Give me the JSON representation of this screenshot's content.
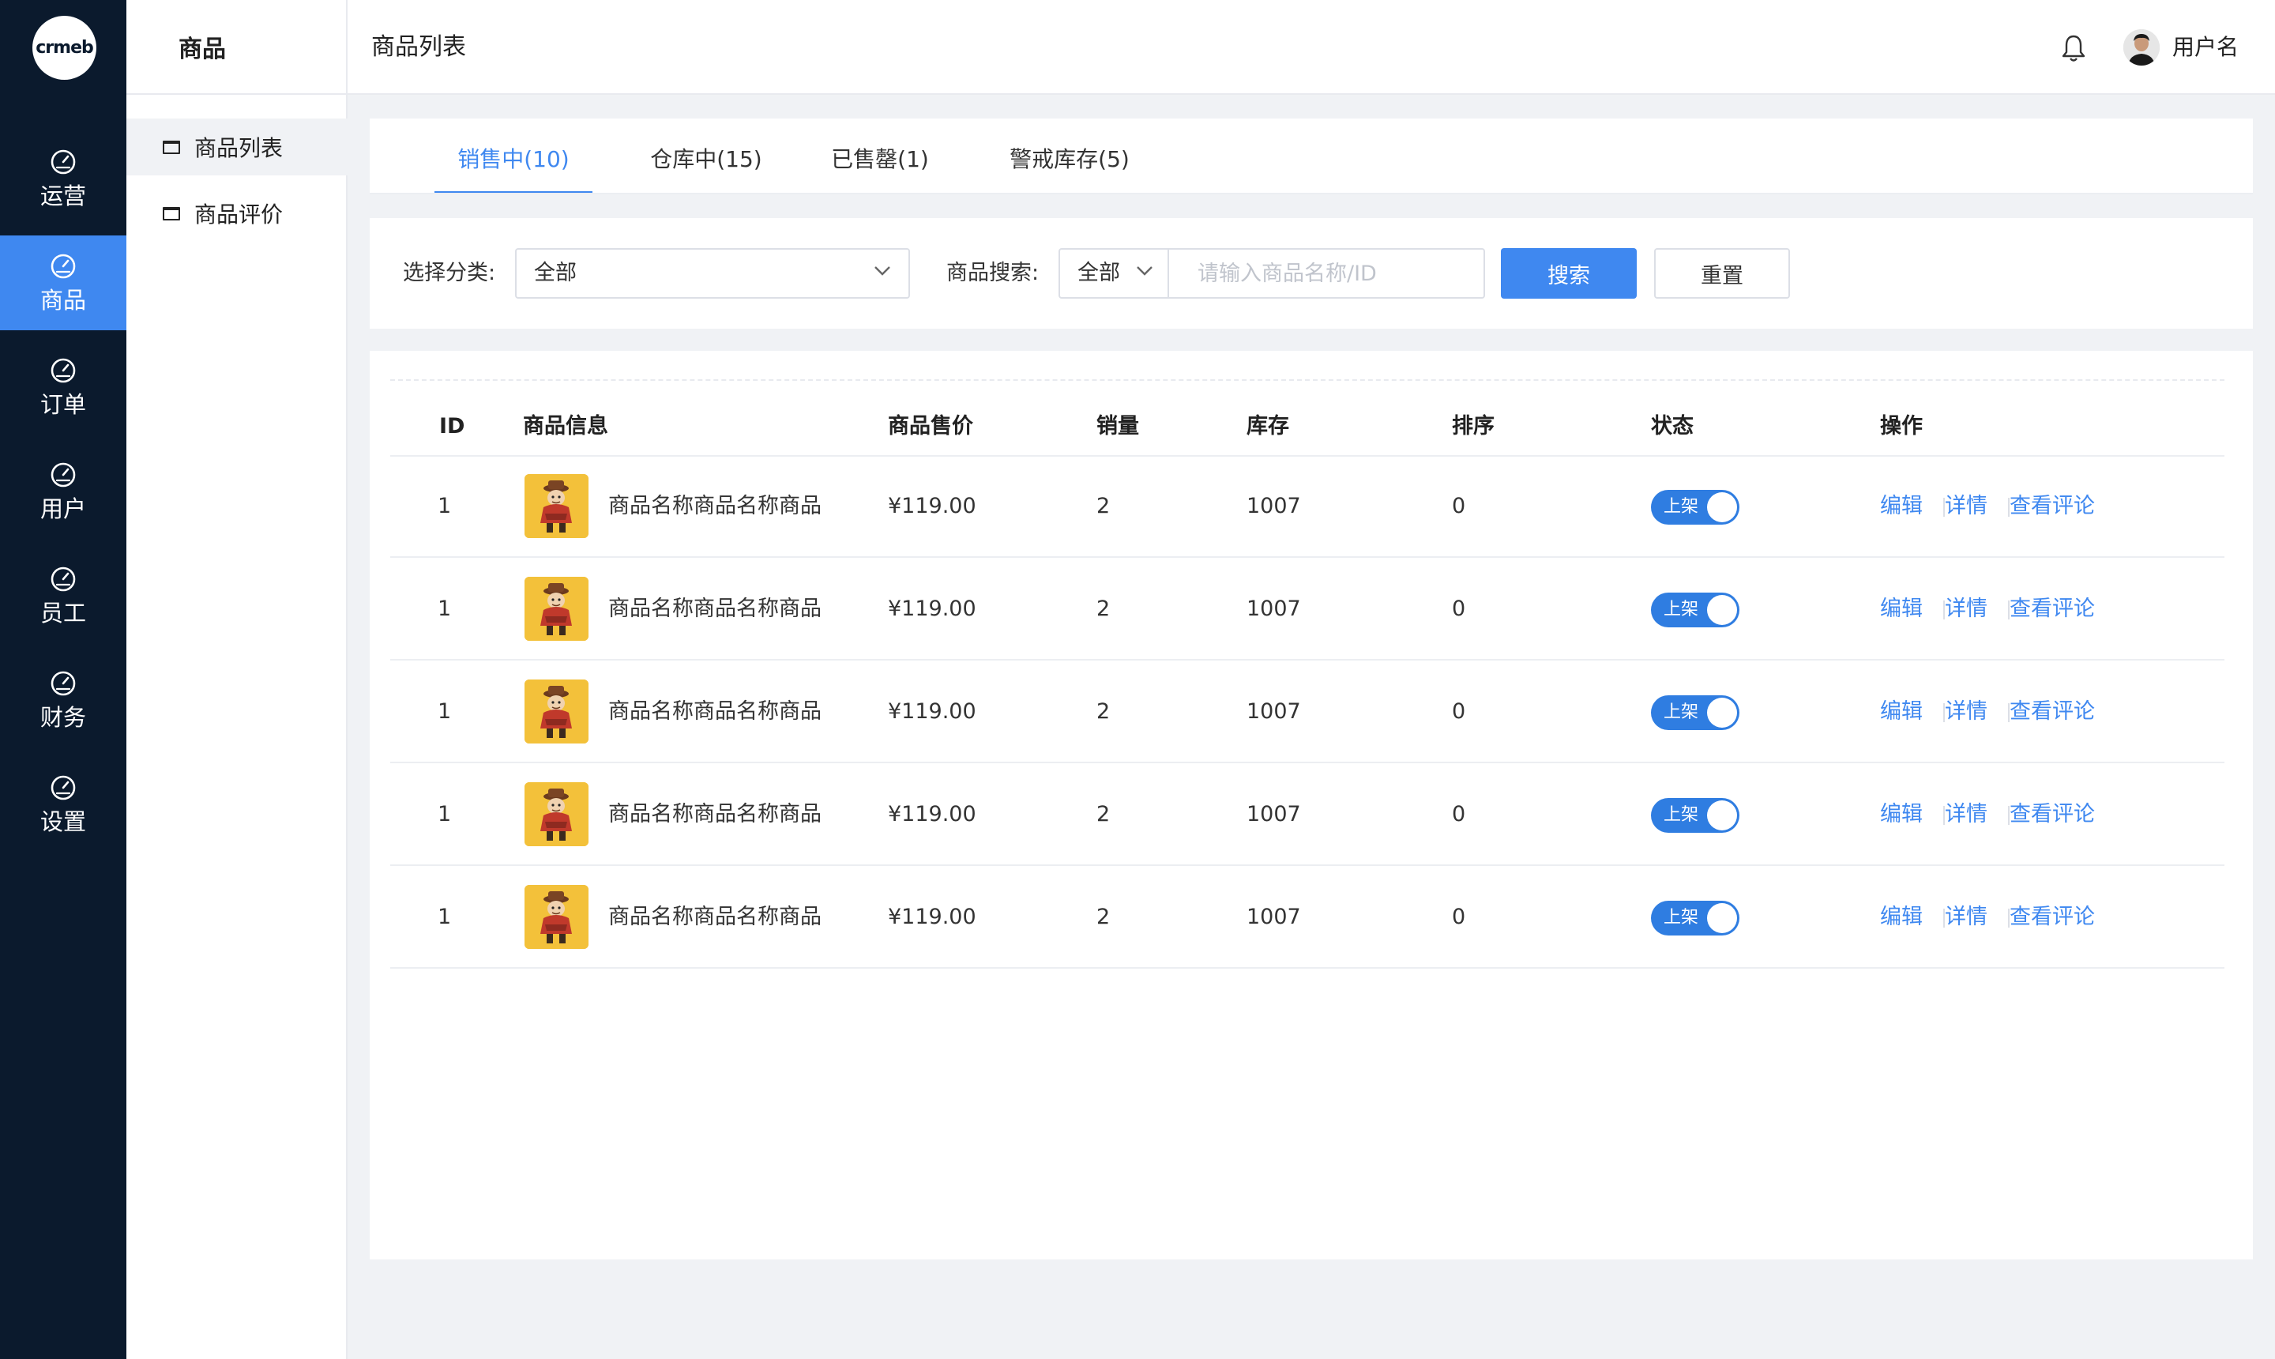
{
  "app": {
    "logo_text": "crmeb",
    "header_title": "商品列表",
    "username": "用户名"
  },
  "rail": {
    "items": [
      {
        "label": "运营",
        "icon": "dashboard-gauge-icon",
        "active": false
      },
      {
        "label": "商品",
        "icon": "dashboard-gauge-icon",
        "active": true
      },
      {
        "label": "订单",
        "icon": "dashboard-gauge-icon",
        "active": false
      },
      {
        "label": "用户",
        "icon": "dashboard-gauge-icon",
        "active": false
      },
      {
        "label": "员工",
        "icon": "dashboard-gauge-icon",
        "active": false
      },
      {
        "label": "财务",
        "icon": "dashboard-gauge-icon",
        "active": false
      },
      {
        "label": "设置",
        "icon": "dashboard-gauge-icon",
        "active": false
      }
    ]
  },
  "submenu": {
    "title": "商品",
    "items": [
      {
        "label": "商品列表",
        "active": true
      },
      {
        "label": "商品评价",
        "active": false
      }
    ]
  },
  "tabs": [
    {
      "label": "销售中(10)",
      "active": true
    },
    {
      "label": "仓库中(15)",
      "active": false
    },
    {
      "label": "已售罄(1)",
      "active": false
    },
    {
      "label": "警戒库存(5)",
      "active": false
    }
  ],
  "filter": {
    "category_label": "选择分类:",
    "category_value": "全部",
    "search_label": "商品搜索:",
    "search_scope_value": "全部",
    "search_placeholder": "请输入商品名称/ID",
    "search_button": "搜索",
    "reset_button": "重置"
  },
  "table": {
    "columns": [
      "ID",
      "商品信息",
      "商品售价",
      "销量",
      "库存",
      "排序",
      "状态",
      "操作"
    ],
    "rows": [
      {
        "id": "1",
        "name": "商品名称商品名称商品",
        "price": "¥119.00",
        "sales": "2",
        "stock": "1007",
        "sort": "0",
        "status": "上架",
        "status_on": true
      },
      {
        "id": "1",
        "name": "商品名称商品名称商品",
        "price": "¥119.00",
        "sales": "2",
        "stock": "1007",
        "sort": "0",
        "status": "上架",
        "status_on": true
      },
      {
        "id": "1",
        "name": "商品名称商品名称商品",
        "price": "¥119.00",
        "sales": "2",
        "stock": "1007",
        "sort": "0",
        "status": "上架",
        "status_on": true
      },
      {
        "id": "1",
        "name": "商品名称商品名称商品",
        "price": "¥119.00",
        "sales": "2",
        "stock": "1007",
        "sort": "0",
        "status": "上架",
        "status_on": true
      },
      {
        "id": "1",
        "name": "商品名称商品名称商品",
        "price": "¥119.00",
        "sales": "2",
        "stock": "1007",
        "sort": "0",
        "status": "上架",
        "status_on": true
      }
    ],
    "actions": [
      "编辑",
      "详情",
      "查看评论"
    ]
  },
  "colors": {
    "rail_bg": "#0b1a2d",
    "accent": "#3f88f0",
    "page_bg": "#f0f2f5"
  }
}
